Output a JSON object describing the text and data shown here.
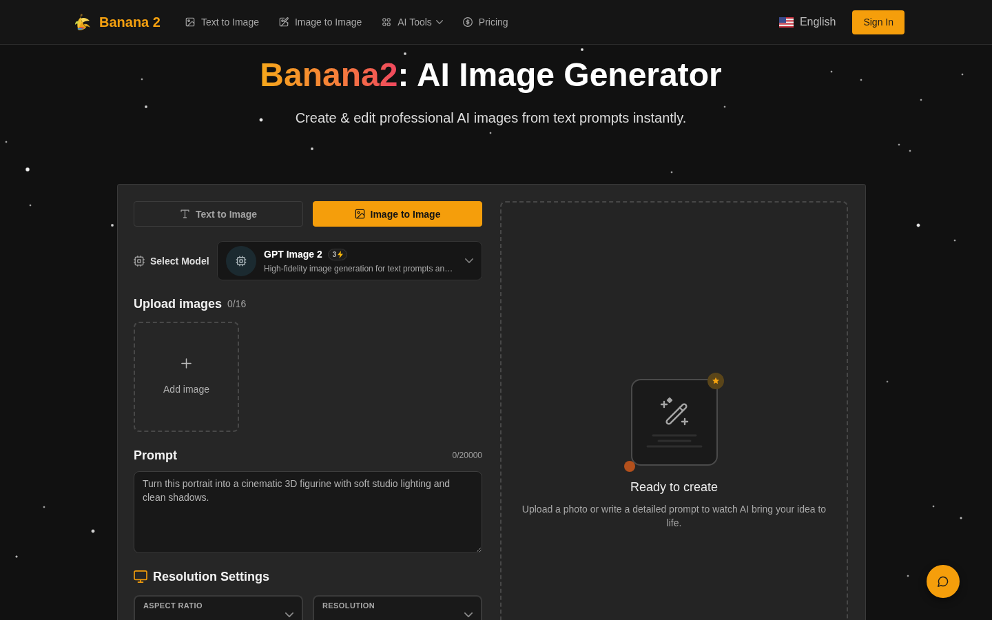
{
  "header": {
    "logo": "Banana 2",
    "nav": [
      {
        "label": "Text to Image",
        "kind": "link"
      },
      {
        "label": "Image to Image",
        "kind": "link"
      },
      {
        "label": "AI Tools",
        "kind": "dropdown"
      },
      {
        "label": "Pricing",
        "kind": "link"
      }
    ],
    "language": "English",
    "sign_in": "Sign In"
  },
  "hero": {
    "title_highlight": "Banana2",
    "title_rest": ": AI Image Generator",
    "subtitle": "Create & edit professional AI images from text prompts instantly."
  },
  "generator": {
    "tabs": [
      {
        "label": "Text to Image",
        "selected": false
      },
      {
        "label": "Image to Image",
        "selected": true
      }
    ],
    "model": {
      "label": "Select Model",
      "name": "GPT Image 2",
      "credits": "3",
      "description": "High-fidelity image generation for text prompts an…"
    },
    "upload": {
      "title": "Upload images",
      "count": "0/16",
      "add_label": "Add image"
    },
    "prompt": {
      "title": "Prompt",
      "count": "0/20000",
      "placeholder": "Turn this portrait into a cinematic 3D figurine with soft studio lighting and clean shadows."
    },
    "resolution": {
      "title": "Resolution Settings",
      "selects": [
        {
          "label": "ASPECT RATIO"
        },
        {
          "label": "RESOLUTION"
        }
      ]
    }
  },
  "preview": {
    "title": "Ready to create",
    "description": "Upload a photo or write a detailed prompt to watch AI bring your idea to life."
  }
}
